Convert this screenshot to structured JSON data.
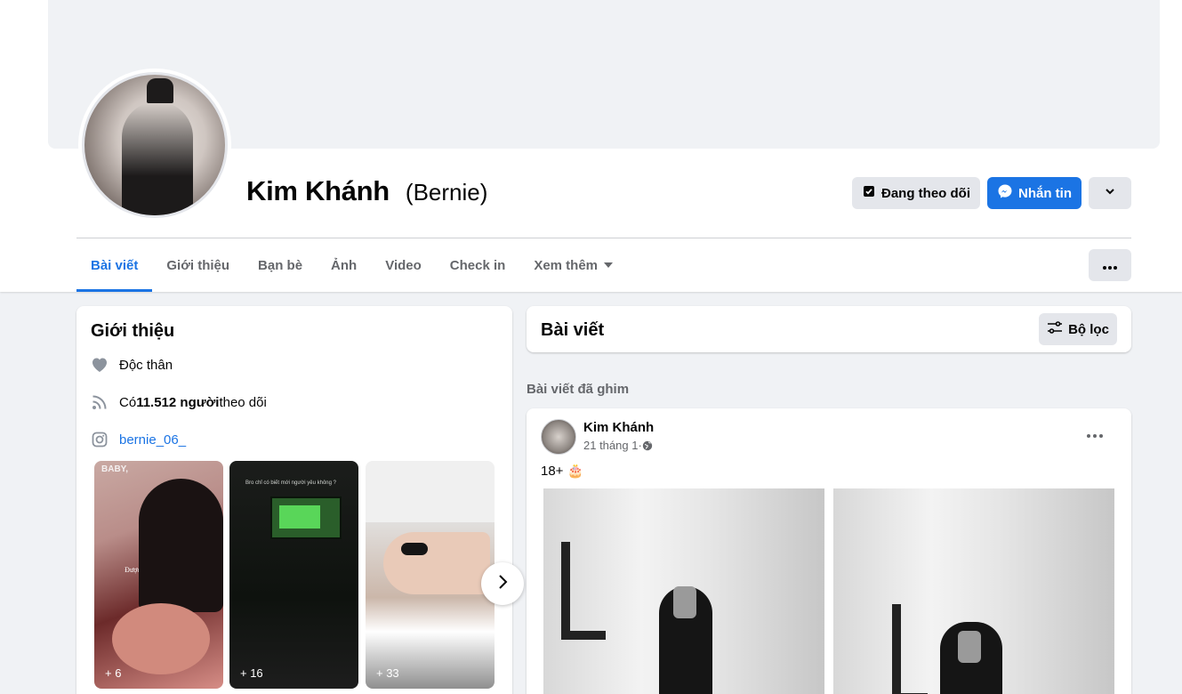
{
  "profile": {
    "name": "Kim Khánh",
    "alt_name": "(Bernie)",
    "following_label": "Đang theo dõi",
    "message_label": "Nhắn tin"
  },
  "tabs": [
    {
      "label": "Bài viết",
      "active": true
    },
    {
      "label": "Giới thiệu"
    },
    {
      "label": "Bạn bè"
    },
    {
      "label": "Ảnh"
    },
    {
      "label": "Video"
    },
    {
      "label": "Check in"
    },
    {
      "label": "Xem thêm"
    }
  ],
  "intro": {
    "title": "Giới thiệu",
    "relationship": "Độc thân",
    "followers_prefix": "Có ",
    "followers_count": "11.512 người",
    "followers_suffix": " theo dõi",
    "instagram": "bernie_06_",
    "stories": [
      {
        "count": "+ 6",
        "caption_top": "BABY,",
        "caption_mid": "Được nhìn em Why, cả là không ạ?"
      },
      {
        "count": "+ 16",
        "caption_top": "Bro chỉ có biết mới người yêu không ?"
      },
      {
        "count": "+ 33"
      }
    ]
  },
  "posts": {
    "title": "Bài viết",
    "filter_label": "Bộ lọc",
    "pinned_label": "Bài viết đã ghim",
    "pinned_post": {
      "author": "Kim Khánh",
      "date": "21 tháng 1",
      "separator": " · ",
      "text": "18+ 🎂"
    }
  },
  "colors": {
    "accent": "#1b74e4",
    "background": "#f0f2f5",
    "secondary_text": "#65676b"
  }
}
